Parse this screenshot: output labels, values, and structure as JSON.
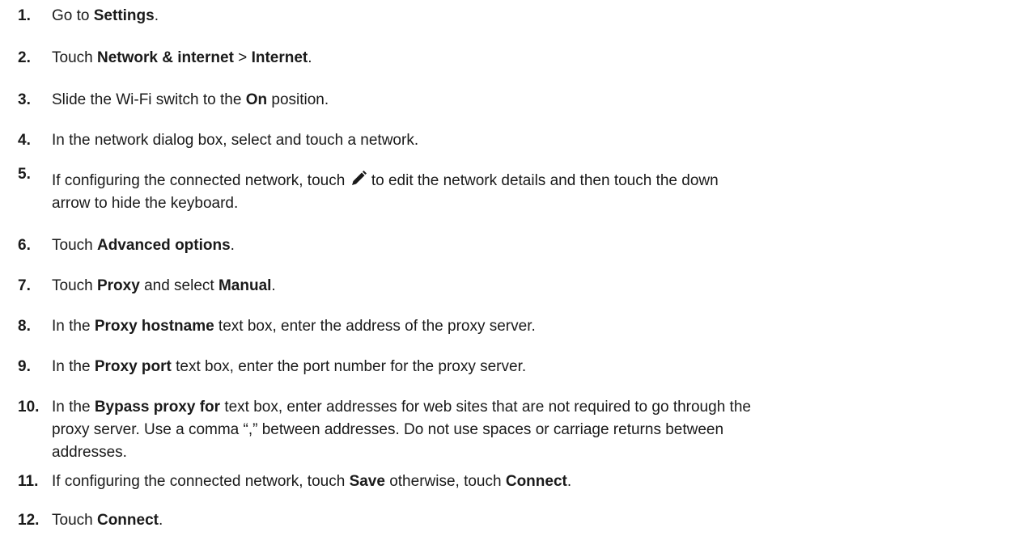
{
  "steps": [
    {
      "number": "1.",
      "parts": [
        "Go to ",
        "Settings",
        "."
      ]
    },
    {
      "number": "2.",
      "parts": [
        "Touch ",
        "Network & internet",
        " > ",
        "Internet",
        "."
      ]
    },
    {
      "number": "3.",
      "parts": [
        "Slide the Wi-Fi switch to the ",
        "On",
        " position."
      ]
    },
    {
      "number": "4.",
      "parts": [
        "In the network dialog box, select and touch a network."
      ]
    },
    {
      "number": "5.",
      "parts": [
        "If configuring the connected network, touch ",
        " to edit the network details and then touch the down",
        "arrow to hide the keyboard."
      ],
      "icon": "pencil-icon"
    },
    {
      "number": "6.",
      "parts": [
        "Touch ",
        "Advanced options",
        "."
      ]
    },
    {
      "number": "7.",
      "parts": [
        "Touch ",
        "Proxy",
        " and select ",
        "Manual",
        "."
      ]
    },
    {
      "number": "8.",
      "parts": [
        "In the ",
        "Proxy hostname",
        " text box, enter the address of the proxy server."
      ]
    },
    {
      "number": "9.",
      "parts": [
        "In the ",
        "Proxy port",
        " text box, enter the port number for the proxy server."
      ]
    },
    {
      "number": "10.",
      "parts": [
        "In the ",
        "Bypass proxy for",
        " text box, enter addresses for web sites that are not required to go through the",
        "proxy server. Use a comma “,” between addresses. Do not use spaces or carriage returns between",
        "addresses."
      ]
    },
    {
      "number": "11.",
      "parts": [
        "If configuring the connected network, touch ",
        "Save",
        " otherwise, touch ",
        "Connect",
        "."
      ]
    },
    {
      "number": "12.",
      "parts": [
        "Touch ",
        "Connect",
        "."
      ]
    }
  ]
}
